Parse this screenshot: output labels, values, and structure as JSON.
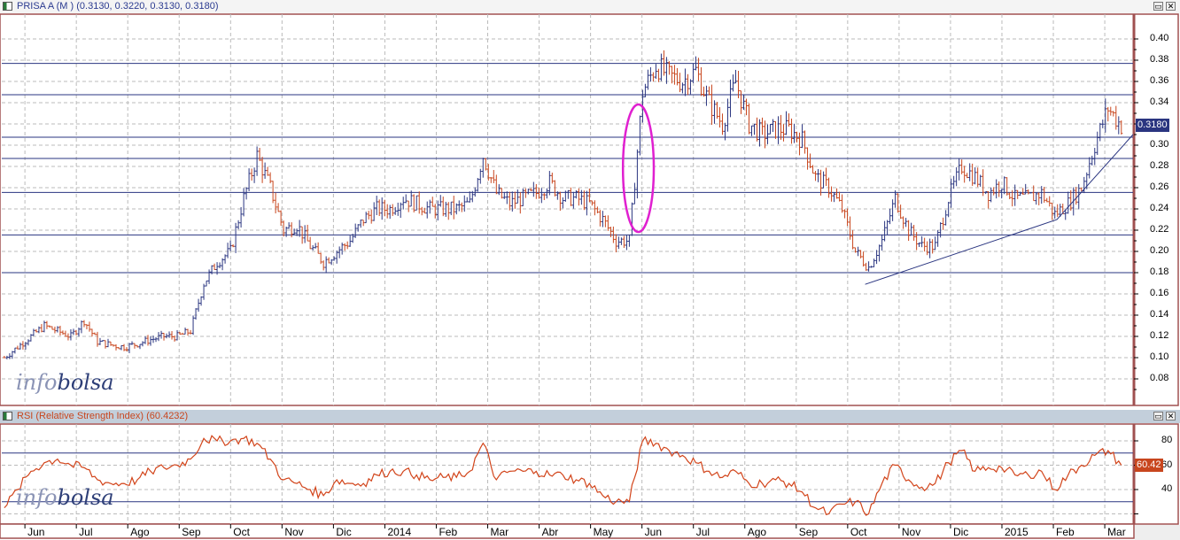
{
  "main_header": {
    "title": "PRISA A (M ) (0.3130, 0.3220, 0.3130, 0.3180)"
  },
  "rsi_header": {
    "title": "RSI (Relative Strength Index) (60.4232)"
  },
  "window_buttons": {
    "restore": "▭",
    "close": "✕"
  },
  "logo": {
    "part1": "info",
    "part2": "bolsa"
  },
  "colors": {
    "up": "#2a3580",
    "down": "#c8461e",
    "rsi_line": "#d2441a",
    "level_line": "#2a3580",
    "ellipse": "#e020d0",
    "border": "#a05050",
    "badge_price": "#2a3580",
    "badge_rsi": "#c8461e"
  },
  "chart_data": [
    {
      "type": "ohlc",
      "title": "PRISA A (M )",
      "last": {
        "open": 0.313,
        "high": 0.322,
        "low": 0.313,
        "close": 0.318
      },
      "last_label": "0.3180",
      "x_unit": "months since Jun 2013",
      "x_start": -0.4,
      "x_step": 0.2586,
      "ylim": [
        0.06,
        0.42
      ],
      "yticks": [
        "0.08",
        "0.10",
        "0.12",
        "0.14",
        "0.16",
        "0.18",
        "0.20",
        "0.22",
        "0.24",
        "0.26",
        "0.28",
        "0.30",
        "0.32",
        "0.34",
        "0.36",
        "0.38",
        "0.40"
      ],
      "closes": [
        0.1,
        0.11,
        0.12,
        0.13,
        0.125,
        0.12,
        0.135,
        0.115,
        0.112,
        0.11,
        0.113,
        0.117,
        0.12,
        0.12,
        0.125,
        0.17,
        0.19,
        0.2,
        0.25,
        0.29,
        0.26,
        0.22,
        0.225,
        0.205,
        0.19,
        0.2,
        0.21,
        0.23,
        0.24,
        0.24,
        0.25,
        0.245,
        0.24,
        0.24,
        0.24,
        0.245,
        0.29,
        0.255,
        0.245,
        0.25,
        0.255,
        0.265,
        0.25,
        0.25,
        0.245,
        0.23,
        0.21,
        0.21,
        0.35,
        0.375,
        0.365,
        0.36,
        0.37,
        0.34,
        0.32,
        0.36,
        0.32,
        0.31,
        0.315,
        0.315,
        0.305,
        0.27,
        0.26,
        0.24,
        0.2,
        0.185,
        0.21,
        0.25,
        0.22,
        0.205,
        0.205,
        0.25,
        0.28,
        0.27,
        0.255,
        0.265,
        0.25,
        0.25,
        0.255,
        0.235,
        0.245,
        0.26,
        0.3,
        0.335,
        0.318
      ],
      "horizontal_levels": [
        0.377,
        0.3475,
        0.3075,
        0.2875,
        0.2555,
        0.2155,
        0.18
      ],
      "trendline": [
        {
          "x": 16.34,
          "y": 0.169
        },
        {
          "x": 20.07,
          "y": 0.23
        },
        {
          "x": 21.55,
          "y": 0.31
        }
      ],
      "ellipse": {
        "cx": 11.93,
        "cy": 0.2783,
        "rx": 0.3,
        "ry": 0.06
      }
    },
    {
      "type": "line",
      "title": "RSI (Relative Strength Index)",
      "last_label": "60.42",
      "x_start": -0.4,
      "x_step": 0.2586,
      "ylim": [
        8,
        93
      ],
      "yticks": [
        "40",
        "60",
        "80"
      ],
      "levels": [
        70,
        30
      ],
      "values": [
        25,
        40,
        55,
        62,
        65,
        60,
        58,
        48,
        45,
        45,
        48,
        55,
        58,
        60,
        65,
        82,
        80,
        80,
        82,
        78,
        65,
        48,
        45,
        40,
        35,
        48,
        45,
        45,
        52,
        55,
        55,
        52,
        48,
        50,
        50,
        55,
        78,
        48,
        55,
        55,
        55,
        52,
        52,
        48,
        45,
        35,
        30,
        30,
        80,
        78,
        72,
        68,
        62,
        55,
        50,
        55,
        45,
        45,
        48,
        45,
        38,
        25,
        20,
        28,
        30,
        20,
        45,
        60,
        48,
        42,
        45,
        62,
        72,
        55,
        58,
        58,
        52,
        52,
        55,
        40,
        52,
        60,
        68,
        72,
        60
      ]
    }
  ],
  "x_axis": {
    "labels": [
      "Jun",
      "Jul",
      "Ago",
      "Sep",
      "Oct",
      "Nov",
      "Dic",
      "2014",
      "Feb",
      "Mar",
      "Abr",
      "May",
      "Jun",
      "Jul",
      "Ago",
      "Sep",
      "Oct",
      "Nov",
      "Dic",
      "2015",
      "Feb",
      "Mar"
    ]
  }
}
